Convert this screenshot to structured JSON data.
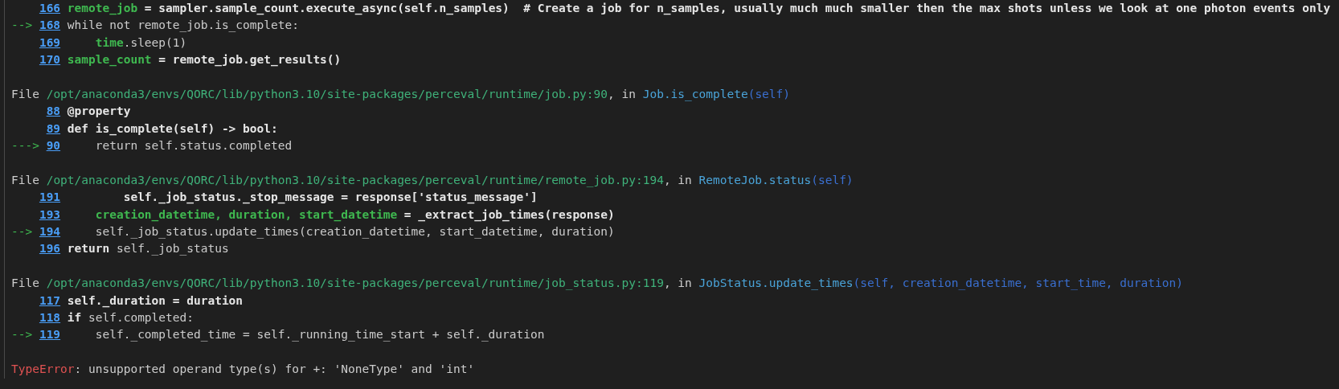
{
  "traceback": {
    "frames": [
      {
        "lines": [
          {
            "number": "166",
            "code": [
              {
                "kind": "name",
                "text": "remote_job"
              },
              {
                "kind": "bold",
                "text": " = sampler.sample_count.execute_async(self.n_samples)  # Create a job for n_samples, usually much much smaller then the max shots unless we look at one photon events only"
              }
            ]
          },
          {
            "marker": "-->",
            "number": "168",
            "code": [
              {
                "kind": "plain",
                "text": "while not remote_job.is_complete:"
              }
            ]
          },
          {
            "number": "169",
            "code": [
              {
                "kind": "name",
                "text": "    time"
              },
              {
                "kind": "plain",
                "text": ".sleep(1)"
              }
            ]
          },
          {
            "number": "170",
            "code": [
              {
                "kind": "name",
                "text": "sample_count"
              },
              {
                "kind": "bold",
                "text": " = remote_job.get_results()"
              }
            ]
          }
        ]
      },
      {
        "file": {
          "label": "File",
          "path": "/opt/anaconda3/envs/QORC/lib/python3.10/site-packages/perceval/runtime/job.py:90",
          "sep": ", in",
          "func": "Job.is_complete",
          "args": "(self)"
        },
        "lines": [
          {
            "number": "88",
            "code": [
              {
                "kind": "bold",
                "text": "@property"
              }
            ]
          },
          {
            "number": "89",
            "code": [
              {
                "kind": "bold",
                "text": "def is_complete(self) -> bool:"
              }
            ]
          },
          {
            "marker": "--->",
            "number": "90",
            "code": [
              {
                "kind": "plain",
                "text": "    return self.status.completed"
              }
            ]
          }
        ]
      },
      {
        "file": {
          "label": "File",
          "path": "/opt/anaconda3/envs/QORC/lib/python3.10/site-packages/perceval/runtime/remote_job.py:194",
          "sep": ", in",
          "func": "RemoteJob.status",
          "args": "(self)"
        },
        "lines": [
          {
            "number": "191",
            "code": [
              {
                "kind": "bold",
                "text": "        self._job_status._stop_message = response['status_message']"
              }
            ]
          },
          {
            "number": "193",
            "code": [
              {
                "kind": "name",
                "text": "    creation_datetime, duration, start_datetime"
              },
              {
                "kind": "bold",
                "text": " = _extract_job_times(response)"
              }
            ]
          },
          {
            "marker": "-->",
            "number": "194",
            "code": [
              {
                "kind": "plain",
                "text": "    self._job_status.update_times(creation_datetime, start_datetime, duration)"
              }
            ]
          },
          {
            "number": "196",
            "code": [
              {
                "kind": "bold",
                "text": "return"
              },
              {
                "kind": "plain",
                "text": " self._job_status"
              }
            ]
          }
        ]
      },
      {
        "file": {
          "label": "File",
          "path": "/opt/anaconda3/envs/QORC/lib/python3.10/site-packages/perceval/runtime/job_status.py:119",
          "sep": ", in",
          "func": "JobStatus.update_times",
          "args": "(self, creation_datetime, start_time, duration)"
        },
        "lines": [
          {
            "number": "117",
            "code": [
              {
                "kind": "bold",
                "text": "self._duration = duration"
              }
            ]
          },
          {
            "number": "118",
            "code": [
              {
                "kind": "bold",
                "text": "if"
              },
              {
                "kind": "plain",
                "text": " self.completed:"
              }
            ]
          },
          {
            "marker": "-->",
            "number": "119",
            "code": [
              {
                "kind": "plain",
                "text": "    self._completed_time = self._running_time_start + self._duration"
              }
            ]
          }
        ]
      }
    ],
    "error": {
      "type": "TypeError",
      "message": ": unsupported operand type(s) for +: 'NoneType' and 'int'"
    }
  }
}
